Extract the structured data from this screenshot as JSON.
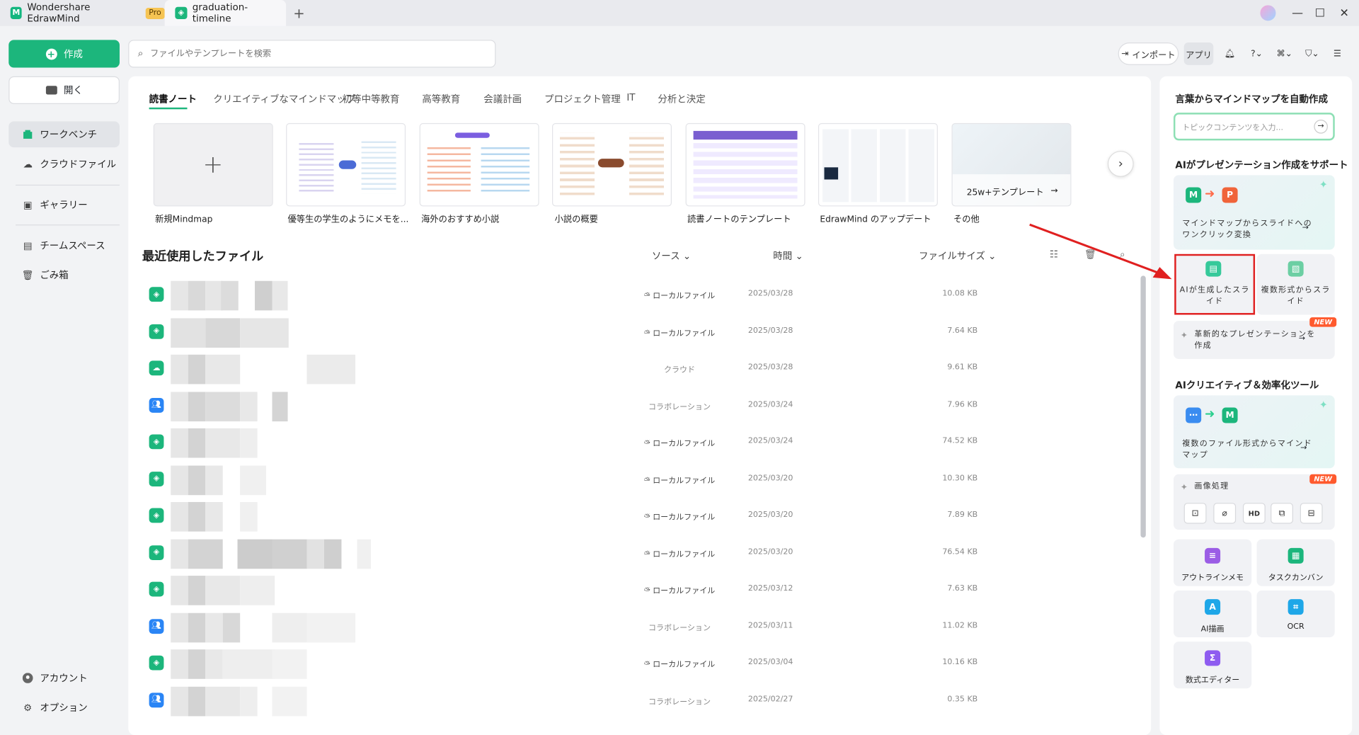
{
  "titlebar": {
    "app_name": "Wondershare EdrawMind",
    "pro_badge": "Pro",
    "doc_tab": "graduation-timeline",
    "new_tab_symbol": "+"
  },
  "sidebar": {
    "create_label": "作成",
    "open_label": "開く",
    "nav": [
      {
        "label": "ワークベンチ",
        "icon": "home-icon",
        "active": true
      },
      {
        "label": "クラウドファイル",
        "icon": "cloud-icon"
      },
      {
        "label": "ギャラリー",
        "icon": "gallery-icon"
      },
      {
        "label": "チームスペース",
        "icon": "team-icon"
      },
      {
        "label": "ごみ箱",
        "icon": "trash-icon"
      }
    ],
    "bottom": [
      {
        "label": "アカウント",
        "icon": "account-icon"
      },
      {
        "label": "オプション",
        "icon": "settings-icon"
      }
    ]
  },
  "search": {
    "placeholder": "ファイルやテンプレートを検索"
  },
  "toolbar": {
    "import_label": "インポート",
    "apps_label": "アプリ"
  },
  "categories": [
    "読書ノート",
    "クリエイティブなマインドマップ",
    "初等中等教育",
    "高等教育",
    "会議計画",
    "プロジェクト管理",
    "IT",
    "分析と決定"
  ],
  "templates": [
    {
      "label": "新規Mindmap"
    },
    {
      "label": "優等生の学生のようにメモを..."
    },
    {
      "label": "海外のおすすめ小説"
    },
    {
      "label": "小説の概要"
    },
    {
      "label": "読書ノートのテンプレート"
    },
    {
      "label": "EdrawMind のアップデート"
    },
    {
      "label": "その他",
      "overlay": "25w+テンプレート"
    }
  ],
  "recent": {
    "title": "最近使用したファイル",
    "col_source": "ソース",
    "col_time": "時間",
    "col_size": "ファイルサイズ",
    "rows": [
      {
        "type": "local",
        "source": "ローカルファイル",
        "time": "2025/03/28",
        "size": "10.08 KB"
      },
      {
        "type": "local",
        "source": "ローカルファイル",
        "time": "2025/03/28",
        "size": "7.64 KB"
      },
      {
        "type": "cloud",
        "source": "クラウド",
        "time": "2025/03/28",
        "size": "9.61 KB"
      },
      {
        "type": "collab",
        "source": "コラボレーション",
        "time": "2025/03/24",
        "size": "7.96 KB"
      },
      {
        "type": "local",
        "source": "ローカルファイル",
        "time": "2025/03/24",
        "size": "74.52 KB"
      },
      {
        "type": "local",
        "source": "ローカルファイル",
        "time": "2025/03/20",
        "size": "10.30 KB"
      },
      {
        "type": "local",
        "source": "ローカルファイル",
        "time": "2025/03/20",
        "size": "7.89 KB"
      },
      {
        "type": "local",
        "source": "ローカルファイル",
        "time": "2025/03/20",
        "size": "76.54 KB"
      },
      {
        "type": "local",
        "source": "ローカルファイル",
        "time": "2025/03/12",
        "size": "7.63 KB"
      },
      {
        "type": "collab",
        "source": "コラボレーション",
        "time": "2025/03/11",
        "size": "11.02 KB"
      },
      {
        "type": "local",
        "source": "ローカルファイル",
        "time": "2025/03/04",
        "size": "10.16 KB"
      },
      {
        "type": "collab",
        "source": "コラボレーション",
        "time": "2025/02/27",
        "size": "0.35 KB"
      }
    ]
  },
  "right_panel": {
    "auto_title": "言葉からマインドマップを自動作成",
    "auto_placeholder": "トピックコンテンツを入力...",
    "present_title": "AIがプレゼンテーション作成をサポート",
    "mm_to_slide": "マインドマップからスライドへのワンクリック変換",
    "ai_slide": "AIが生成したスライド",
    "multi_slide": "複数形式からスライド",
    "innovative": "革新的なプレゼンテーションを作成",
    "new_badge": "NEW",
    "tools_title": "AIクリエイティブ＆効率化ツール",
    "multi_to_mm": "複数のファイル形式からマインドマップ",
    "image_proc": "画像処理",
    "tools": [
      {
        "label": "アウトラインメモ",
        "icon": "outline-icon",
        "color": "#9b5de5"
      },
      {
        "label": "タスクカンバン",
        "icon": "kanban-icon",
        "color": "#1cb67c"
      },
      {
        "label": "AI描画",
        "icon": "ai-draw-icon",
        "color": "#1ea7e8"
      },
      {
        "label": "OCR",
        "icon": "ocr-icon",
        "color": "#1ea7e8"
      },
      {
        "label": "数式エディター",
        "icon": "formula-icon",
        "color": "#8e5cf0"
      }
    ]
  }
}
